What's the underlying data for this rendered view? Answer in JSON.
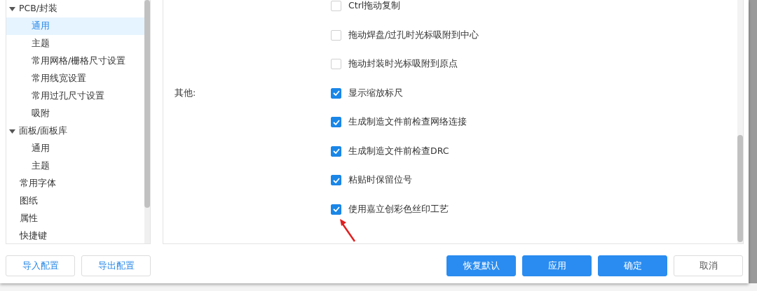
{
  "sidebar": {
    "items": [
      {
        "label": "PCB/封装",
        "expanded": true,
        "selected": false,
        "children": [
          {
            "label": "通用",
            "selected": true
          },
          {
            "label": "主题",
            "selected": false
          },
          {
            "label": "常用网格/栅格尺寸设置",
            "selected": false
          },
          {
            "label": "常用线宽设置",
            "selected": false
          },
          {
            "label": "常用过孔尺寸设置",
            "selected": false
          },
          {
            "label": "吸附",
            "selected": false
          }
        ]
      },
      {
        "label": "面板/面板库",
        "expanded": true,
        "selected": false,
        "children": [
          {
            "label": "通用",
            "selected": false
          },
          {
            "label": "主题",
            "selected": false
          }
        ]
      },
      {
        "label": "常用字体",
        "selected": false
      },
      {
        "label": "图纸",
        "selected": false
      },
      {
        "label": "属性",
        "selected": false
      },
      {
        "label": "快捷键",
        "selected": false
      }
    ]
  },
  "option_groups": [
    {
      "options": [
        {
          "label": "Ctrl拖动复制",
          "checked": false
        },
        {
          "label": "拖动焊盘/过孔时光标吸附到中心",
          "checked": false
        },
        {
          "label": "拖动封装时光标吸附到原点",
          "checked": false
        }
      ]
    },
    {
      "label": "其他:",
      "options": [
        {
          "label": "显示缩放标尺",
          "checked": true
        },
        {
          "label": "生成制造文件前检查网络连接",
          "checked": true
        },
        {
          "label": "生成制造文件前检查DRC",
          "checked": true
        },
        {
          "label": "粘贴时保留位号",
          "checked": true
        },
        {
          "label": "使用嘉立创彩色丝印工艺",
          "checked": true
        }
      ]
    }
  ],
  "left_buttons": [
    "导入配置",
    "导出配置"
  ],
  "right_buttons": [
    {
      "label": "恢复默认",
      "kind": "primary"
    },
    {
      "label": "应用",
      "kind": "primary"
    },
    {
      "label": "确定",
      "kind": "primary"
    },
    {
      "label": "取消",
      "kind": "plain"
    }
  ]
}
